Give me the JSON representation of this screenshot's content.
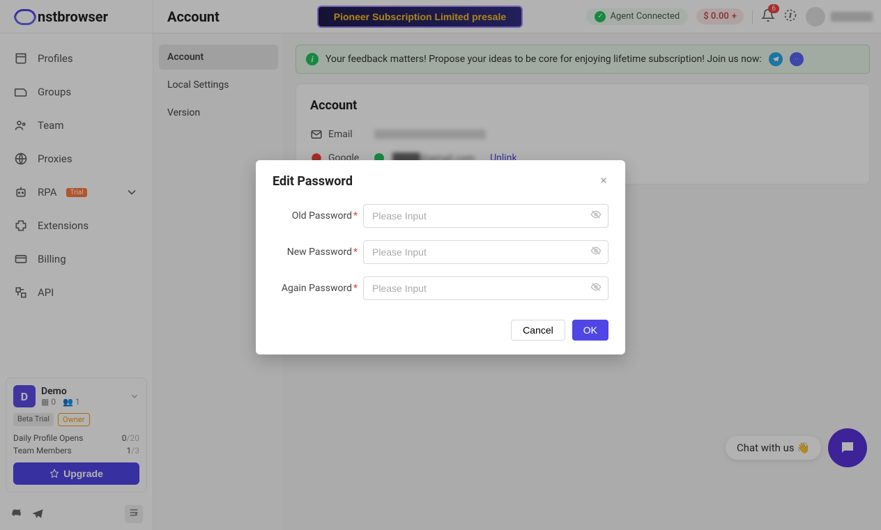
{
  "brand": "nstbrowser",
  "page_title": "Account",
  "presale": "Pioneer Subscription Limited presale",
  "agent_status": "Agent Connected",
  "balance": "$ 0.00",
  "notifications_count": "6",
  "sidebar": {
    "items": [
      {
        "label": "Profiles"
      },
      {
        "label": "Groups"
      },
      {
        "label": "Team"
      },
      {
        "label": "Proxies"
      },
      {
        "label": "RPA",
        "trial": "Trial"
      },
      {
        "label": "Extensions"
      },
      {
        "label": "Billing"
      },
      {
        "label": "API"
      }
    ]
  },
  "team_card": {
    "initial": "D",
    "name": "Demo",
    "profiles_count": "0",
    "members_count": "1",
    "beta": "Beta Trial",
    "owner": "Owner",
    "daily_label": "Daily Profile Opens",
    "daily_value": "0",
    "daily_max": "/20",
    "members_label": "Team Members",
    "members_value": "1",
    "members_max": "/3",
    "upgrade": "Upgrade"
  },
  "subnav": {
    "account": "Account",
    "local": "Local Settings",
    "version": "Version"
  },
  "banner": {
    "text": "Your feedback matters! Propose your ideas to be core for enjoying lifetime subscription! Join us now:"
  },
  "account": {
    "heading": "Account",
    "email_label": "Email",
    "google_label": "Google",
    "unlink": "Unlink"
  },
  "modal": {
    "title": "Edit Password",
    "old_label": "Old Password",
    "new_label": "New Password",
    "again_label": "Again Password",
    "placeholder": "Please Input",
    "cancel": "Cancel",
    "ok": "OK"
  },
  "chat": "Chat with us 👋"
}
